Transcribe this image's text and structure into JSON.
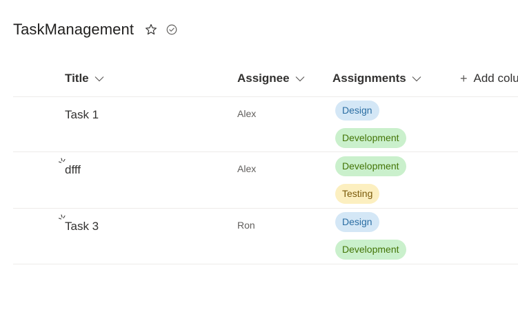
{
  "list": {
    "title": "TaskManagement",
    "favorite_icon": "star-icon",
    "status_icon": "check-circle-icon"
  },
  "columns": {
    "title": "Title",
    "assignee": "Assignee",
    "assignments": "Assignments",
    "add_column": "Add colu"
  },
  "rows": [
    {
      "title": "Task 1",
      "assignee": "Alex",
      "is_new": false,
      "tags": [
        "Design",
        "Development"
      ]
    },
    {
      "title": "dfff",
      "assignee": "Alex",
      "is_new": true,
      "tags": [
        "Development",
        "Testing"
      ]
    },
    {
      "title": "Task 3",
      "assignee": "Ron",
      "is_new": true,
      "tags": [
        "Design",
        "Development"
      ]
    }
  ],
  "tag_colors": {
    "Design": {
      "bg": "#d4e7f6",
      "fg": "#2b6ea3"
    },
    "Development": {
      "bg": "#caf0cc",
      "fg": "#437406"
    },
    "Testing": {
      "bg": "#fcefc0",
      "fg": "#7a5a0a"
    }
  }
}
